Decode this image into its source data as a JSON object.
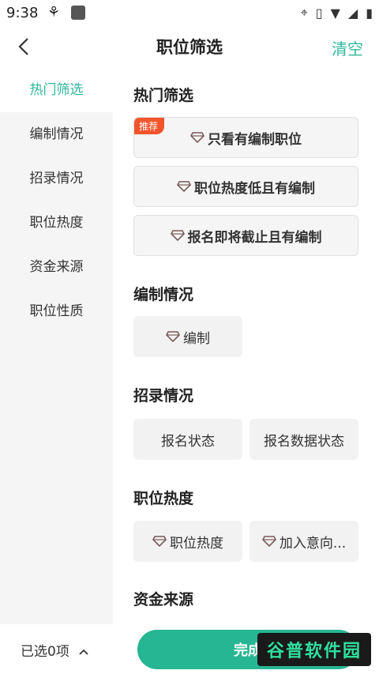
{
  "status_bar": {
    "time": "9:38",
    "left_icons": [
      "bug-icon",
      "app-icon"
    ],
    "right_icons": [
      "location-icon",
      "vibrate-icon",
      "wifi-icon",
      "signal-icon",
      "battery-icon"
    ]
  },
  "nav": {
    "back_icon": "chevron-left-icon",
    "title": "职位筛选",
    "clear_label": "清空"
  },
  "sidebar": {
    "items": [
      {
        "label": "热门筛选",
        "active": true
      },
      {
        "label": "编制情况",
        "active": false
      },
      {
        "label": "招录情况",
        "active": false
      },
      {
        "label": "职位热度",
        "active": false
      },
      {
        "label": "资金来源",
        "active": false
      },
      {
        "label": "职位性质",
        "active": false
      }
    ]
  },
  "sections": {
    "hot": {
      "title": "热门筛选",
      "badge": "推荐",
      "options": [
        "只看有编制职位",
        "职位热度低且有编制",
        "报名即将截止且有编制"
      ]
    },
    "bianzhi": {
      "title": "编制情况",
      "options": [
        "编制"
      ]
    },
    "zhaolu": {
      "title": "招录情况",
      "options": [
        "报名状态",
        "报名数据状态"
      ]
    },
    "redu": {
      "title": "职位热度",
      "options": [
        "职位热度",
        "加入意向..."
      ]
    },
    "zijin": {
      "title": "资金来源"
    }
  },
  "colors": {
    "accent": "#2fb99c",
    "button": "#27b693",
    "badge": "#f2552c",
    "gem": "#e0707a"
  },
  "bottom": {
    "selected_label": "已选0项",
    "chevron_icon": "chevron-up-icon",
    "done_label": "完成"
  },
  "watermark": {
    "text": "谷普软件园"
  }
}
